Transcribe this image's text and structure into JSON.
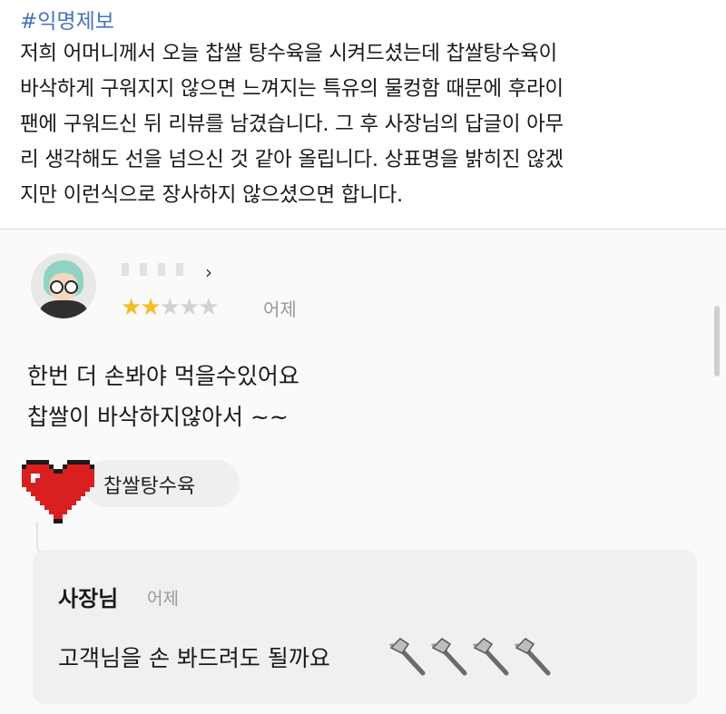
{
  "post": {
    "hashtag": "#익명제보",
    "lines": [
      "저희 어머니께서 오늘 찹쌀 탕수육을 시켜드셨는데 찹쌀탕수육이",
      "바삭하게 구워지지 않으면 느껴지는 특유의 물컹함 때문에 후라이",
      "팬에 구워드신 뒤 리뷰를 남겼습니다. 그 후 사장님의 답글이 아무",
      "리 생각해도 선을 넘으신 것 같아 올립니다. 상표명을 밝히진 않겠",
      "지만 이런식으로 장사하지 않으셨으면 합니다."
    ]
  },
  "review": {
    "avatar_icon": "avatar-icon",
    "chevron": "›",
    "rating": 2,
    "rating_max": 5,
    "date": "어제",
    "text_lines": [
      "한번 더 손봐야  먹을수있어요",
      "찹쌀이 바삭하지않아서 ~~"
    ],
    "menu_icon": "heart-icon",
    "menu_item": "찹쌀탕수육"
  },
  "reply": {
    "author": "사장님",
    "date": "어제",
    "text": "고객님을 손 봐드려도 될까요",
    "emoji_icon": "hammer-icon",
    "emoji_count": 4
  },
  "colors": {
    "hashtag": "#4a74b8",
    "star_on": "#f2c026",
    "star_off": "#d2d2d2",
    "heart": "#d91f1f"
  }
}
